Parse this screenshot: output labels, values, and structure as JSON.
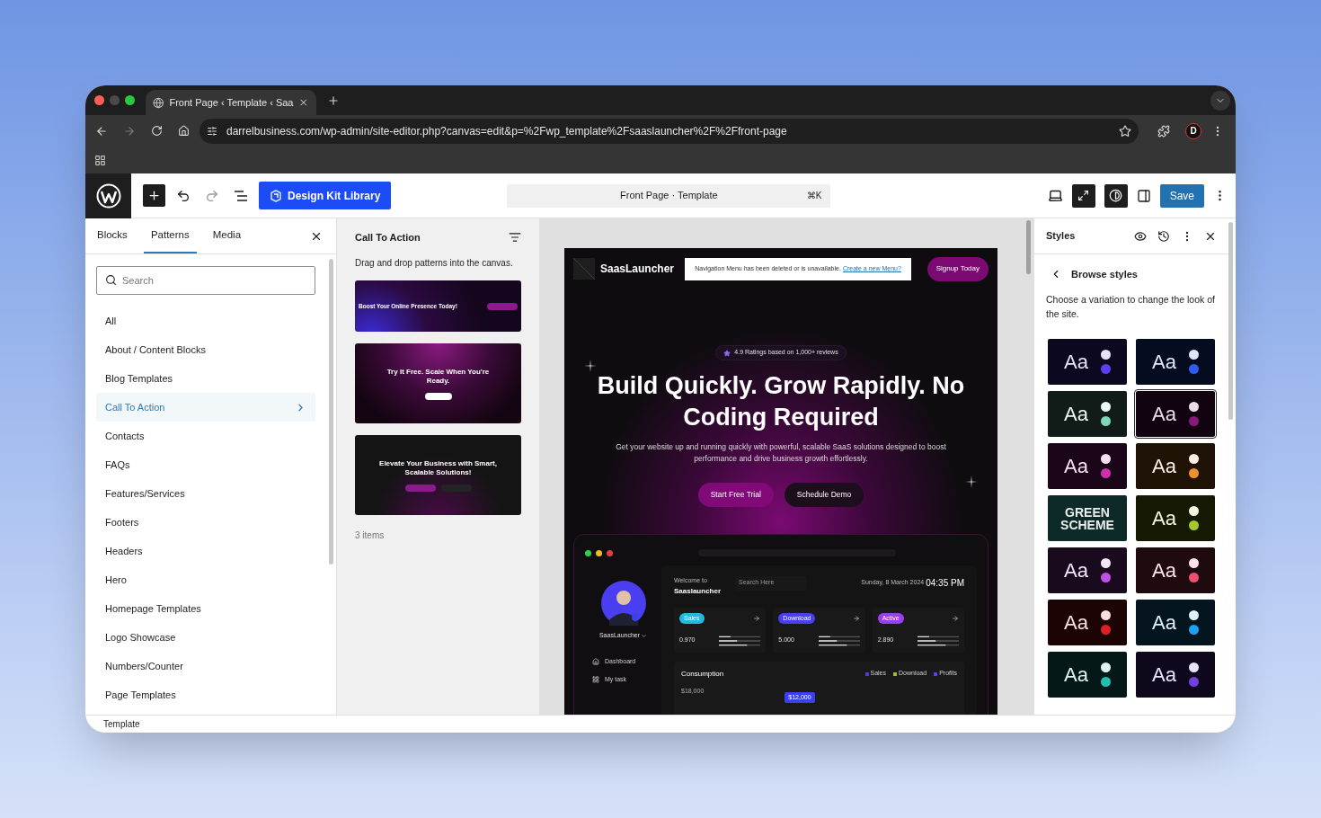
{
  "browser": {
    "tab_title": "Front Page ‹ Template ‹ Saa",
    "url": "darrelbusiness.com/wp-admin/site-editor.php?canvas=edit&p=%2Fwp_template%2Fsaaslauncher%2F%2Ffront-page",
    "profile_initial": "D"
  },
  "toolbar": {
    "design_kit_button": "Design Kit Library",
    "document_title": "Front Page · Template",
    "shortcut": "⌘K",
    "save_button": "Save"
  },
  "inserter": {
    "tabs": [
      {
        "label": "Blocks",
        "selected": false
      },
      {
        "label": "Patterns",
        "selected": true
      },
      {
        "label": "Media",
        "selected": false
      }
    ],
    "search_placeholder": "Search",
    "categories": [
      {
        "label": "All",
        "selected": false
      },
      {
        "label": "About / Content Blocks",
        "selected": false
      },
      {
        "label": "Blog Templates",
        "selected": false
      },
      {
        "label": "Call To Action",
        "selected": true
      },
      {
        "label": "Contacts",
        "selected": false
      },
      {
        "label": "FAQs",
        "selected": false
      },
      {
        "label": "Features/Services",
        "selected": false
      },
      {
        "label": "Footers",
        "selected": false
      },
      {
        "label": "Headers",
        "selected": false
      },
      {
        "label": "Hero",
        "selected": false
      },
      {
        "label": "Homepage Templates",
        "selected": false
      },
      {
        "label": "Logo Showcase",
        "selected": false
      },
      {
        "label": "Numbers/Counter",
        "selected": false
      },
      {
        "label": "Page Templates",
        "selected": false
      }
    ]
  },
  "patterns": {
    "title": "Call To Action",
    "hint": "Drag and drop patterns into the canvas.",
    "items": [
      {
        "kind": "banner",
        "headline": "Boost Your Online Presence Today!"
      },
      {
        "kind": "glow",
        "headline": "Try It Free. Scale When You're Ready."
      },
      {
        "kind": "dark",
        "headline": "Elevate Your Business with Smart, Scalable Solutions!"
      }
    ],
    "count": "3 items"
  },
  "canvas": {
    "site_name": "SaasLauncher",
    "nav_notice": "Navigation Menu has been deleted or is unavailable.",
    "nav_link": "Create a new Menu?",
    "signup_button": "Signup Today",
    "rating": "4.9 Ratings based on 1,000+ reviews",
    "heading": "Build Quickly. Grow Rapidly. No Coding Required",
    "subtitle": "Get your website up and running quickly with powerful, scalable SaaS solutions designed to boost performance and drive business growth effortlessly.",
    "buttons": [
      {
        "label": "Start Free Trial",
        "kind": "primary"
      },
      {
        "label": "Schedule Demo",
        "kind": "secondary"
      }
    ],
    "dashboard": {
      "user_name": "SaasLauncher",
      "nav": [
        {
          "label": "Dashboard",
          "kind": "home"
        },
        {
          "label": "My task",
          "kind": "grid"
        }
      ],
      "welcome": "Welcome to",
      "title": "Saaslauncher",
      "search_placeholder": "Search Here",
      "date": "Sunday, 8 March 2024",
      "time": "04:35 PM",
      "stats": [
        {
          "label": "Sales",
          "value": "0.970",
          "color": "#22b8e0"
        },
        {
          "label": "Download",
          "value": "5.000",
          "color": "#4a3ff0"
        },
        {
          "label": "Active",
          "value": "2.890",
          "color": "#9a3ff0"
        }
      ],
      "chart_title": "Consumption",
      "legend": [
        {
          "label": "Sales",
          "color": "#4a3fd0"
        },
        {
          "label": "Download",
          "color": "#a8b838"
        },
        {
          "label": "Profits",
          "color": "#5a40f0"
        }
      ],
      "axis_label": "$18,000",
      "tooltip": "$12,000"
    }
  },
  "styles": {
    "title": "Styles",
    "back_label": "Browse styles",
    "description": "Choose a variation to change the look of the site.",
    "variations": [
      {
        "kind": "sample",
        "text": "Aa",
        "color": "#5b3ff0",
        "selected": false
      },
      {
        "kind": "sample",
        "text": "Aa",
        "color": "#2f5cf0",
        "selected": false
      },
      {
        "kind": "sample",
        "text": "Aa",
        "color": "#7fd6b8",
        "selected": false
      },
      {
        "kind": "sample",
        "text": "Aa",
        "color": "#8a1a7a",
        "selected": true
      },
      {
        "kind": "sample",
        "text": "Aa",
        "color": "#d030b0",
        "selected": false
      },
      {
        "kind": "sample",
        "text": "Aa",
        "color": "#f09030",
        "selected": false
      },
      {
        "kind": "label",
        "text": "GREEN SCHEME",
        "color": "#0e2a28",
        "selected": false
      },
      {
        "kind": "sample",
        "text": "Aa",
        "color": "#a8c828",
        "selected": false
      },
      {
        "kind": "sample",
        "text": "Aa",
        "color": "#c050e8",
        "selected": false
      },
      {
        "kind": "sample",
        "text": "Aa",
        "color": "#f05070",
        "selected": false
      },
      {
        "kind": "sample",
        "text": "Aa",
        "color": "#e02020",
        "selected": false
      },
      {
        "kind": "sample",
        "text": "Aa",
        "color": "#20a0f0",
        "selected": false
      },
      {
        "kind": "sample",
        "text": "Aa",
        "color": "#20c0b0",
        "selected": false
      },
      {
        "kind": "sample",
        "text": "Aa",
        "color": "#7040e0",
        "selected": false
      }
    ]
  },
  "footer": "Template"
}
